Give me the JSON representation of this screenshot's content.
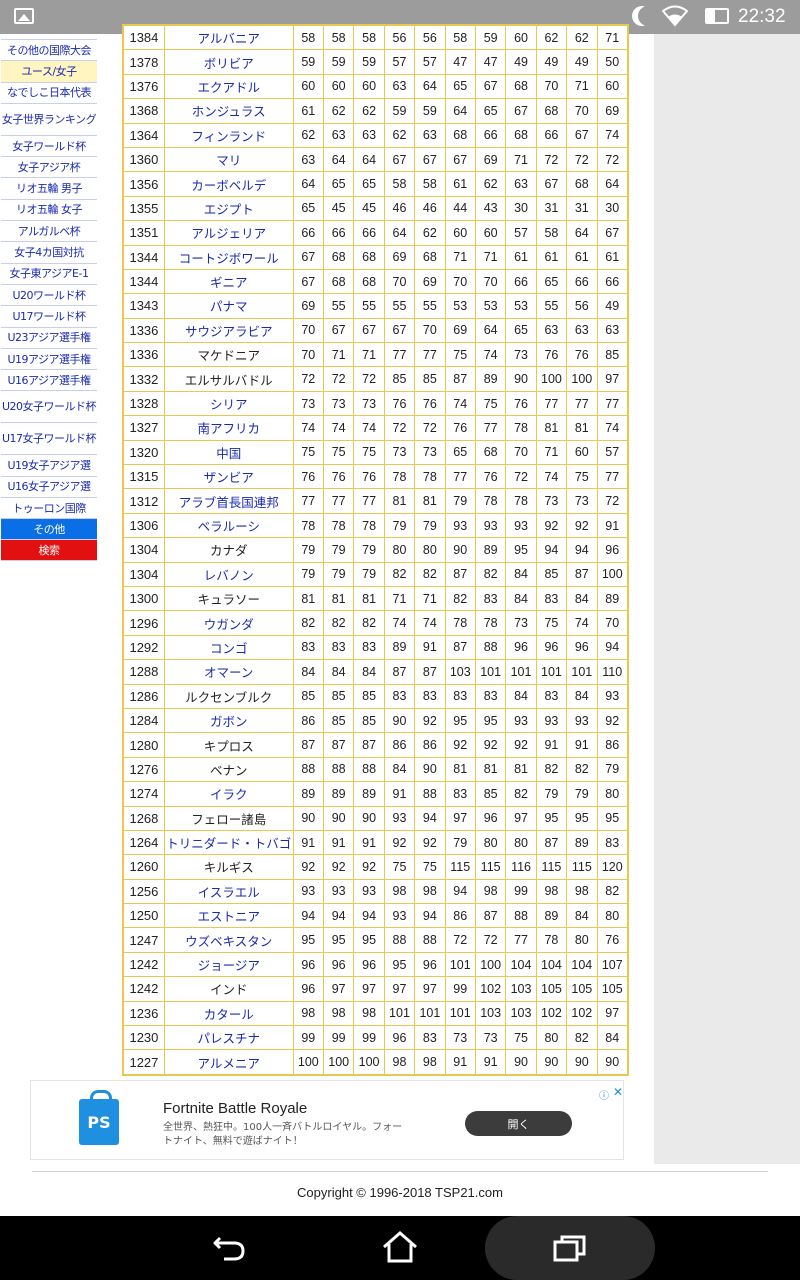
{
  "status_bar": {
    "time": "22:32",
    "icons": [
      "image-icon",
      "moon-icon",
      "wifi-icon",
      "battery-icon"
    ]
  },
  "sidebar": {
    "items": [
      {
        "label": "その他の国際大会",
        "state": "normal"
      },
      {
        "label": "ユース/女子",
        "state": "selected"
      },
      {
        "label": "なでしこ日本代表",
        "state": "normal"
      },
      {
        "label": "女子世界ランキング",
        "state": "tall"
      },
      {
        "label": "女子ワールド杯",
        "state": "normal"
      },
      {
        "label": "女子アジア杯",
        "state": "normal"
      },
      {
        "label": "リオ五輪 男子",
        "state": "normal"
      },
      {
        "label": "リオ五輪 女子",
        "state": "normal"
      },
      {
        "label": "アルガルベ杯",
        "state": "normal"
      },
      {
        "label": "女子4カ国対抗",
        "state": "normal"
      },
      {
        "label": "女子東アジアE-1",
        "state": "normal"
      },
      {
        "label": "U20ワールド杯",
        "state": "normal"
      },
      {
        "label": "U17ワールド杯",
        "state": "normal"
      },
      {
        "label": "U23アジア選手権",
        "state": "normal"
      },
      {
        "label": "U19アジア選手権",
        "state": "normal"
      },
      {
        "label": "U16アジア選手権",
        "state": "normal"
      },
      {
        "label": "U20女子ワールド杯",
        "state": "tall"
      },
      {
        "label": "U17女子ワールド杯",
        "state": "tall"
      },
      {
        "label": "U19女子アジア選",
        "state": "normal"
      },
      {
        "label": "U16女子アジア選",
        "state": "normal"
      },
      {
        "label": "トゥーロン国際",
        "state": "normal"
      },
      {
        "label": "その他",
        "state": "blue"
      },
      {
        "label": "検索",
        "state": "red"
      }
    ]
  },
  "ranking_table": {
    "rows": [
      {
        "pts": "1384",
        "name": "アルバニア",
        "link": true,
        "v": [
          "58",
          "58",
          "58",
          "56",
          "56",
          "58",
          "59",
          "60",
          "62",
          "62",
          "71"
        ]
      },
      {
        "pts": "1378",
        "name": "ボリビア",
        "link": true,
        "v": [
          "59",
          "59",
          "59",
          "57",
          "57",
          "47",
          "47",
          "49",
          "49",
          "49",
          "50"
        ]
      },
      {
        "pts": "1376",
        "name": "エクアドル",
        "link": true,
        "v": [
          "60",
          "60",
          "60",
          "63",
          "64",
          "65",
          "67",
          "68",
          "70",
          "71",
          "60"
        ]
      },
      {
        "pts": "1368",
        "name": "ホンジュラス",
        "link": true,
        "v": [
          "61",
          "62",
          "62",
          "59",
          "59",
          "64",
          "65",
          "67",
          "68",
          "70",
          "69"
        ]
      },
      {
        "pts": "1364",
        "name": "フィンランド",
        "link": true,
        "v": [
          "62",
          "63",
          "63",
          "62",
          "63",
          "68",
          "66",
          "68",
          "66",
          "67",
          "74"
        ]
      },
      {
        "pts": "1360",
        "name": "マリ",
        "link": true,
        "v": [
          "63",
          "64",
          "64",
          "67",
          "67",
          "67",
          "69",
          "71",
          "72",
          "72",
          "72"
        ]
      },
      {
        "pts": "1356",
        "name": "カーボベルデ",
        "link": true,
        "v": [
          "64",
          "65",
          "65",
          "58",
          "58",
          "61",
          "62",
          "63",
          "67",
          "68",
          "64"
        ]
      },
      {
        "pts": "1355",
        "name": "エジプト",
        "link": true,
        "v": [
          "65",
          "45",
          "45",
          "46",
          "46",
          "44",
          "43",
          "30",
          "31",
          "31",
          "30"
        ]
      },
      {
        "pts": "1351",
        "name": "アルジェリア",
        "link": true,
        "v": [
          "66",
          "66",
          "66",
          "64",
          "62",
          "60",
          "60",
          "57",
          "58",
          "64",
          "67"
        ]
      },
      {
        "pts": "1344",
        "name": "コートジボワール",
        "link": true,
        "v": [
          "67",
          "68",
          "68",
          "69",
          "68",
          "71",
          "71",
          "61",
          "61",
          "61",
          "61"
        ]
      },
      {
        "pts": "1344",
        "name": "ギニア",
        "link": true,
        "v": [
          "67",
          "68",
          "68",
          "70",
          "69",
          "70",
          "70",
          "66",
          "65",
          "66",
          "66"
        ]
      },
      {
        "pts": "1343",
        "name": "パナマ",
        "link": true,
        "v": [
          "69",
          "55",
          "55",
          "55",
          "55",
          "53",
          "53",
          "53",
          "55",
          "56",
          "49"
        ]
      },
      {
        "pts": "1336",
        "name": "サウジアラビア",
        "link": true,
        "v": [
          "70",
          "67",
          "67",
          "67",
          "70",
          "69",
          "64",
          "65",
          "63",
          "63",
          "63"
        ]
      },
      {
        "pts": "1336",
        "name": "マケドニア",
        "link": false,
        "v": [
          "70",
          "71",
          "71",
          "77",
          "77",
          "75",
          "74",
          "73",
          "76",
          "76",
          "85"
        ]
      },
      {
        "pts": "1332",
        "name": "エルサルバドル",
        "link": false,
        "v": [
          "72",
          "72",
          "72",
          "85",
          "85",
          "87",
          "89",
          "90",
          "100",
          "100",
          "97"
        ]
      },
      {
        "pts": "1328",
        "name": "シリア",
        "link": true,
        "v": [
          "73",
          "73",
          "73",
          "76",
          "76",
          "74",
          "75",
          "76",
          "77",
          "77",
          "77"
        ]
      },
      {
        "pts": "1327",
        "name": "南アフリカ",
        "link": true,
        "v": [
          "74",
          "74",
          "74",
          "72",
          "72",
          "76",
          "77",
          "78",
          "81",
          "81",
          "74"
        ]
      },
      {
        "pts": "1320",
        "name": "中国",
        "link": true,
        "v": [
          "75",
          "75",
          "75",
          "73",
          "73",
          "65",
          "68",
          "70",
          "71",
          "60",
          "57"
        ]
      },
      {
        "pts": "1315",
        "name": "ザンビア",
        "link": true,
        "v": [
          "76",
          "76",
          "76",
          "78",
          "78",
          "77",
          "76",
          "72",
          "74",
          "75",
          "77"
        ]
      },
      {
        "pts": "1312",
        "name": "アラブ首長国連邦",
        "link": true,
        "v": [
          "77",
          "77",
          "77",
          "81",
          "81",
          "79",
          "78",
          "78",
          "73",
          "73",
          "72"
        ]
      },
      {
        "pts": "1306",
        "name": "ベラルーシ",
        "link": true,
        "v": [
          "78",
          "78",
          "78",
          "79",
          "79",
          "93",
          "93",
          "93",
          "92",
          "92",
          "91"
        ]
      },
      {
        "pts": "1304",
        "name": "カナダ",
        "link": false,
        "v": [
          "79",
          "79",
          "79",
          "80",
          "80",
          "90",
          "89",
          "95",
          "94",
          "94",
          "96"
        ]
      },
      {
        "pts": "1304",
        "name": "レバノン",
        "link": true,
        "v": [
          "79",
          "79",
          "79",
          "82",
          "82",
          "87",
          "82",
          "84",
          "85",
          "87",
          "100"
        ]
      },
      {
        "pts": "1300",
        "name": "キュラソー",
        "link": false,
        "v": [
          "81",
          "81",
          "81",
          "71",
          "71",
          "82",
          "83",
          "84",
          "83",
          "84",
          "89"
        ]
      },
      {
        "pts": "1296",
        "name": "ウガンダ",
        "link": true,
        "v": [
          "82",
          "82",
          "82",
          "74",
          "74",
          "78",
          "78",
          "73",
          "75",
          "74",
          "70"
        ]
      },
      {
        "pts": "1292",
        "name": "コンゴ",
        "link": true,
        "v": [
          "83",
          "83",
          "83",
          "89",
          "91",
          "87",
          "88",
          "96",
          "96",
          "96",
          "94"
        ]
      },
      {
        "pts": "1288",
        "name": "オマーン",
        "link": true,
        "v": [
          "84",
          "84",
          "84",
          "87",
          "87",
          "103",
          "101",
          "101",
          "101",
          "101",
          "110"
        ]
      },
      {
        "pts": "1286",
        "name": "ルクセンブルク",
        "link": false,
        "v": [
          "85",
          "85",
          "85",
          "83",
          "83",
          "83",
          "83",
          "84",
          "83",
          "84",
          "93"
        ]
      },
      {
        "pts": "1284",
        "name": "ガボン",
        "link": true,
        "v": [
          "86",
          "85",
          "85",
          "90",
          "92",
          "95",
          "95",
          "93",
          "93",
          "93",
          "92"
        ]
      },
      {
        "pts": "1280",
        "name": "キプロス",
        "link": false,
        "v": [
          "87",
          "87",
          "87",
          "86",
          "86",
          "92",
          "92",
          "92",
          "91",
          "91",
          "86"
        ]
      },
      {
        "pts": "1276",
        "name": "ベナン",
        "link": false,
        "v": [
          "88",
          "88",
          "88",
          "84",
          "90",
          "81",
          "81",
          "81",
          "82",
          "82",
          "79"
        ]
      },
      {
        "pts": "1274",
        "name": "イラク",
        "link": true,
        "v": [
          "89",
          "89",
          "89",
          "91",
          "88",
          "83",
          "85",
          "82",
          "79",
          "79",
          "80"
        ]
      },
      {
        "pts": "1268",
        "name": "フェロー諸島",
        "link": false,
        "v": [
          "90",
          "90",
          "90",
          "93",
          "94",
          "97",
          "96",
          "97",
          "95",
          "95",
          "95"
        ]
      },
      {
        "pts": "1264",
        "name": "トリニダード・トバゴ",
        "link": true,
        "v": [
          "91",
          "91",
          "91",
          "92",
          "92",
          "79",
          "80",
          "80",
          "87",
          "89",
          "83"
        ]
      },
      {
        "pts": "1260",
        "name": "キルギス",
        "link": false,
        "v": [
          "92",
          "92",
          "92",
          "75",
          "75",
          "115",
          "115",
          "116",
          "115",
          "115",
          "120"
        ]
      },
      {
        "pts": "1256",
        "name": "イスラエル",
        "link": true,
        "v": [
          "93",
          "93",
          "93",
          "98",
          "98",
          "94",
          "98",
          "99",
          "98",
          "98",
          "82"
        ]
      },
      {
        "pts": "1250",
        "name": "エストニア",
        "link": true,
        "v": [
          "94",
          "94",
          "94",
          "93",
          "94",
          "86",
          "87",
          "88",
          "89",
          "84",
          "80"
        ]
      },
      {
        "pts": "1247",
        "name": "ウズベキスタン",
        "link": true,
        "v": [
          "95",
          "95",
          "95",
          "88",
          "88",
          "72",
          "72",
          "77",
          "78",
          "80",
          "76"
        ]
      },
      {
        "pts": "1242",
        "name": "ジョージア",
        "link": true,
        "v": [
          "96",
          "96",
          "96",
          "95",
          "96",
          "101",
          "100",
          "104",
          "104",
          "104",
          "107"
        ]
      },
      {
        "pts": "1242",
        "name": "インド",
        "link": false,
        "v": [
          "96",
          "97",
          "97",
          "97",
          "97",
          "99",
          "102",
          "103",
          "105",
          "105",
          "105"
        ]
      },
      {
        "pts": "1236",
        "name": "カタール",
        "link": true,
        "v": [
          "98",
          "98",
          "98",
          "101",
          "101",
          "101",
          "103",
          "103",
          "102",
          "102",
          "97"
        ]
      },
      {
        "pts": "1230",
        "name": "パレスチナ",
        "link": true,
        "v": [
          "99",
          "99",
          "99",
          "96",
          "83",
          "73",
          "73",
          "75",
          "80",
          "82",
          "84"
        ]
      },
      {
        "pts": "1227",
        "name": "アルメニア",
        "link": true,
        "v": [
          "100",
          "100",
          "100",
          "98",
          "98",
          "91",
          "91",
          "90",
          "90",
          "90",
          "90"
        ]
      }
    ]
  },
  "ad": {
    "title": "Fortnite Battle Royale",
    "desc": "全世界、熱狂中。100人一斉バトルロイヤル。フォートナイト、無料で遊ばナイト！",
    "button": "開く",
    "icon": "playstation-store-icon"
  },
  "footer": {
    "copyright": "Copyright © 1996-2018 TSP21.com"
  },
  "colors": {
    "link": "#1a2ab0",
    "table_border": "#e7c850",
    "selected_bg": "#fff5c0",
    "blue_btn": "#0a6ee6",
    "red_btn": "#e21010"
  }
}
